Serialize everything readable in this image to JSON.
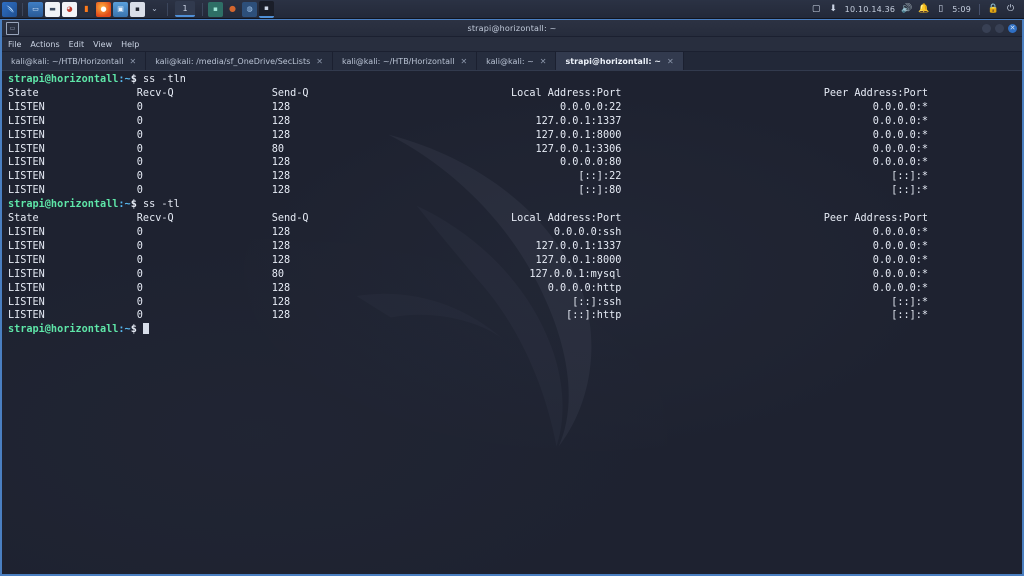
{
  "panel": {
    "launcher_icon": "kali-dragon-icon",
    "quick_launch": [
      {
        "name": "terminal-icon",
        "glyph": "▭"
      },
      {
        "name": "files-icon",
        "glyph": "▬"
      },
      {
        "name": "text-editor-icon",
        "glyph": "▤"
      },
      {
        "name": "burpsuite-icon",
        "glyph": "▮"
      },
      {
        "name": "firefox-icon",
        "glyph": "●"
      },
      {
        "name": "virtualbox-icon",
        "glyph": "▣"
      },
      {
        "name": "terminal-dark-icon",
        "glyph": "▪"
      },
      {
        "name": "chevron-down-icon",
        "glyph": "⌄"
      }
    ],
    "workspace": "1",
    "window_buttons": [
      {
        "name": "window-button-terminal",
        "glyph": "▪"
      },
      {
        "name": "window-button-firefox",
        "glyph": "●"
      },
      {
        "name": "window-button-browser",
        "glyph": "◍"
      },
      {
        "name": "window-button-active-terminal",
        "glyph": "▪"
      }
    ],
    "tray": {
      "display_icon": "screen-icon",
      "vpn_icon": "openvpn-icon",
      "ip_address": "10.10.14.36",
      "volume_icon": "speaker-icon",
      "notifications_icon": "bell-icon",
      "battery_icon": "battery-icon",
      "clock": "5:09",
      "lock_icon": "lock-icon",
      "power_icon": "power-icon"
    }
  },
  "window": {
    "title": "strapi@horizontall: ~",
    "app_icon": "terminal-icon",
    "controls": {
      "minimize": "minimize-button",
      "maximize": "maximize-button",
      "close": "✕"
    },
    "menu": [
      "File",
      "Actions",
      "Edit",
      "View",
      "Help"
    ],
    "tabs": [
      {
        "label": "kali@kali: ~/HTB/Horizontall",
        "active": false
      },
      {
        "label": "kali@kali: /media/sf_OneDrive/SecLists",
        "active": false
      },
      {
        "label": "kali@kali: ~/HTB/Horizontall",
        "active": false
      },
      {
        "label": "kali@kali: ~",
        "active": false
      },
      {
        "label": "strapi@horizontall: ~",
        "active": true
      }
    ],
    "tab_close_glyph": "✕"
  },
  "terminal": {
    "prompt": {
      "user_host": "strapi@horizontall",
      "path": ":~",
      "sigil": "$"
    },
    "blocks": [
      {
        "command": "ss -tln",
        "header": {
          "state": "State",
          "recvq": "Recv-Q",
          "sendq": "Send-Q",
          "local": "Local Address:Port",
          "peer": "Peer Address:Port"
        },
        "rows": [
          {
            "state": "LISTEN",
            "recvq": "0",
            "sendq": "128",
            "local": "0.0.0.0:22",
            "peer": "0.0.0.0:*"
          },
          {
            "state": "LISTEN",
            "recvq": "0",
            "sendq": "128",
            "local": "127.0.0.1:1337",
            "peer": "0.0.0.0:*"
          },
          {
            "state": "LISTEN",
            "recvq": "0",
            "sendq": "128",
            "local": "127.0.0.1:8000",
            "peer": "0.0.0.0:*"
          },
          {
            "state": "LISTEN",
            "recvq": "0",
            "sendq": "80",
            "local": "127.0.0.1:3306",
            "peer": "0.0.0.0:*"
          },
          {
            "state": "LISTEN",
            "recvq": "0",
            "sendq": "128",
            "local": "0.0.0.0:80",
            "peer": "0.0.0.0:*"
          },
          {
            "state": "LISTEN",
            "recvq": "0",
            "sendq": "128",
            "local": "[::]:22",
            "peer": "[::]:*"
          },
          {
            "state": "LISTEN",
            "recvq": "0",
            "sendq": "128",
            "local": "[::]:80",
            "peer": "[::]:*"
          }
        ]
      },
      {
        "command": "ss -tl",
        "header": {
          "state": "State",
          "recvq": "Recv-Q",
          "sendq": "Send-Q",
          "local": "Local Address:Port",
          "peer": "Peer Address:Port"
        },
        "rows": [
          {
            "state": "LISTEN",
            "recvq": "0",
            "sendq": "128",
            "local": "0.0.0.0:ssh",
            "peer": "0.0.0.0:*"
          },
          {
            "state": "LISTEN",
            "recvq": "0",
            "sendq": "128",
            "local": "127.0.0.1:1337",
            "peer": "0.0.0.0:*"
          },
          {
            "state": "LISTEN",
            "recvq": "0",
            "sendq": "128",
            "local": "127.0.0.1:8000",
            "peer": "0.0.0.0:*"
          },
          {
            "state": "LISTEN",
            "recvq": "0",
            "sendq": "80",
            "local": "127.0.0.1:mysql",
            "peer": "0.0.0.0:*"
          },
          {
            "state": "LISTEN",
            "recvq": "0",
            "sendq": "128",
            "local": "0.0.0.0:http",
            "peer": "0.0.0.0:*"
          },
          {
            "state": "LISTEN",
            "recvq": "0",
            "sendq": "128",
            "local": "[::]:ssh",
            "peer": "[::]:*"
          },
          {
            "state": "LISTEN",
            "recvq": "0",
            "sendq": "128",
            "local": "[::]:http",
            "peer": "[::]:*"
          }
        ]
      }
    ]
  },
  "colors": {
    "prompt_user": "#5ee6a8",
    "prompt_path": "#57b8f0",
    "text": "#d6dbe6",
    "window_border": "#4a7fc1",
    "terminal_bg": "#1e2230",
    "panel_bg": "#2b3244"
  }
}
